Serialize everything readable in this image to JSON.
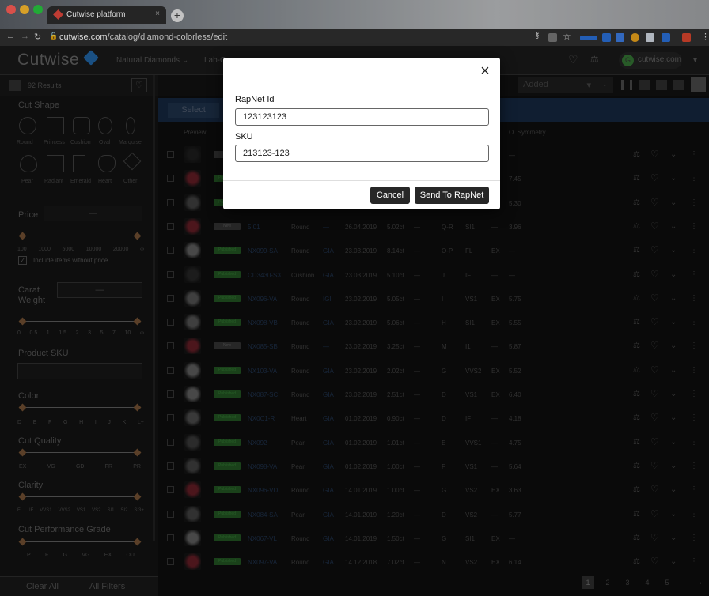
{
  "browser": {
    "tab_title": "Cutwise platform",
    "close_tab": "×",
    "new_tab": "+",
    "url_host": "cutwise.com",
    "url_path": "/catalog/diamond-colorless/edit"
  },
  "header": {
    "logo": "Cutwise",
    "nav": [
      {
        "label": "Natural Diamonds"
      },
      {
        "label": "Lab-G"
      }
    ],
    "user": "cutwise.com",
    "user_initial": "G"
  },
  "sidebar": {
    "results": "92 Results",
    "cut_shape": "Cut Shape",
    "shapes_row1": [
      "Round",
      "Princess",
      "Cushion",
      "Oval",
      "Marquise"
    ],
    "shapes_row2": [
      "Pear",
      "Radiant",
      "Emerald",
      "Heart",
      "Other"
    ],
    "price": "Price",
    "price_dash": "—",
    "price_ticks": [
      "100",
      "1000",
      "5000",
      "10000",
      "20000",
      "∞"
    ],
    "include_without_price": "Include items without price",
    "carat_weight": "Carat Weight",
    "carat_ticks": [
      "0",
      "0.5",
      "1",
      "1.5",
      "2",
      "3",
      "5",
      "7",
      "10",
      "∞"
    ],
    "product_sku": "Product SKU",
    "color": "Color",
    "color_ticks": [
      "D",
      "E",
      "F",
      "G",
      "H",
      "I",
      "J",
      "K",
      "L+"
    ],
    "cut_quality": "Cut Quality",
    "cut_quality_ticks": [
      "EX",
      "VG",
      "GD",
      "FR",
      "PR"
    ],
    "clarity": "Clarity",
    "clarity_ticks": [
      "FL",
      "IF",
      "VVS1",
      "VVS2",
      "VS1",
      "VS2",
      "SI1",
      "SI2",
      "SI3+"
    ],
    "cut_performance": "Cut Performance Grade",
    "cut_performance_ticks": [
      "P",
      "F",
      "G",
      "VG",
      "EX",
      "OU"
    ],
    "clear_all": "Clear All",
    "all_filters": "All Filters"
  },
  "toolbar": {
    "sort_label": "Added",
    "select_button": "Select"
  },
  "table": {
    "preview_header": "Preview",
    "symmetry_header": "O. Symmetry",
    "rows": [
      {
        "status": "New",
        "sku": "",
        "shape": "",
        "lab": "",
        "date": "",
        "carat": "",
        "cut": "",
        "color": "",
        "clarity": "",
        "sym": "",
        "score": "—",
        "thumb": "#1a1a1a"
      },
      {
        "status": "Published",
        "sku": "",
        "shape": "",
        "lab": "",
        "date": "",
        "carat": "",
        "cut": "",
        "color": "",
        "clarity": "",
        "sym": "",
        "score": "7.45",
        "thumb": "#5a1a22"
      },
      {
        "status": "Published",
        "sku": "",
        "shape": "",
        "lab": "",
        "date": "",
        "carat": "",
        "cut": "",
        "color": "",
        "clarity": "",
        "sym": "",
        "score": "5.30",
        "thumb": "#3a3a3a"
      },
      {
        "status": "New",
        "sku": "5.01",
        "shape": "Round",
        "lab": "—",
        "date": "26.04.2019",
        "carat": "5.02ct",
        "cut": "—",
        "color": "Q-R",
        "clarity": "SI1",
        "sym": "—",
        "score": "3.96",
        "thumb": "#5a1a22"
      },
      {
        "status": "Published",
        "sku": "NX099-SA",
        "shape": "Round",
        "lab": "GIA",
        "date": "23.03.2019",
        "carat": "8.14ct",
        "cut": "—",
        "color": "O-P",
        "clarity": "FL",
        "sym": "EX",
        "score": "—",
        "thumb": "#555555"
      },
      {
        "status": "Published",
        "sku": "CD3430-S3",
        "shape": "Cushion",
        "lab": "GIA",
        "date": "23.03.2019",
        "carat": "5.10ct",
        "cut": "—",
        "color": "J",
        "clarity": "IF",
        "sym": "—",
        "score": "—",
        "thumb": "#222222"
      },
      {
        "status": "Published",
        "sku": "NX096-VA",
        "shape": "Round",
        "lab": "IGI",
        "date": "23.02.2019",
        "carat": "5.05ct",
        "cut": "—",
        "color": "I",
        "clarity": "VS1",
        "sym": "EX",
        "score": "5.75",
        "thumb": "#4a4a4a"
      },
      {
        "status": "Published",
        "sku": "NX098-VB",
        "shape": "Round",
        "lab": "GIA",
        "date": "23.02.2019",
        "carat": "5.06ct",
        "cut": "—",
        "color": "H",
        "clarity": "SI1",
        "sym": "EX",
        "score": "5.55",
        "thumb": "#4a4a4a"
      },
      {
        "status": "New",
        "sku": "NX085-SB",
        "shape": "Round",
        "lab": "—",
        "date": "23.02.2019",
        "carat": "3.25ct",
        "cut": "—",
        "color": "M",
        "clarity": "I1",
        "sym": "—",
        "score": "5.87",
        "thumb": "#5a1a22"
      },
      {
        "status": "Published",
        "sku": "NX103-VA",
        "shape": "Round",
        "lab": "GIA",
        "date": "23.02.2019",
        "carat": "2.02ct",
        "cut": "—",
        "color": "G",
        "clarity": "VVS2",
        "sym": "EX",
        "score": "5.52",
        "thumb": "#555555"
      },
      {
        "status": "Published",
        "sku": "NX087-SC",
        "shape": "Round",
        "lab": "GIA",
        "date": "23.02.2019",
        "carat": "2.51ct",
        "cut": "—",
        "color": "D",
        "clarity": "VS1",
        "sym": "EX",
        "score": "6.40",
        "thumb": "#555555"
      },
      {
        "status": "Published",
        "sku": "NX0C1-R",
        "shape": "Heart",
        "lab": "GIA",
        "date": "01.02.2019",
        "carat": "0.90ct",
        "cut": "—",
        "color": "D",
        "clarity": "IF",
        "sym": "—",
        "score": "4.18",
        "thumb": "#444444"
      },
      {
        "status": "Published",
        "sku": "NX092",
        "shape": "Pear",
        "lab": "GIA",
        "date": "01.02.2019",
        "carat": "1.01ct",
        "cut": "—",
        "color": "E",
        "clarity": "VVS1",
        "sym": "—",
        "score": "4.75",
        "thumb": "#333333"
      },
      {
        "status": "Published",
        "sku": "NX098-VA",
        "shape": "Pear",
        "lab": "GIA",
        "date": "01.02.2019",
        "carat": "1.00ct",
        "cut": "—",
        "color": "F",
        "clarity": "VS1",
        "sym": "—",
        "score": "5.64",
        "thumb": "#3a3a3a"
      },
      {
        "status": "Published",
        "sku": "NX096-VD",
        "shape": "Round",
        "lab": "GIA",
        "date": "14.01.2019",
        "carat": "1.00ct",
        "cut": "—",
        "color": "G",
        "clarity": "VS2",
        "sym": "EX",
        "score": "3.63",
        "thumb": "#5a1a22"
      },
      {
        "status": "Published",
        "sku": "NX084-SA",
        "shape": "Pear",
        "lab": "GIA",
        "date": "14.01.2019",
        "carat": "1.20ct",
        "cut": "—",
        "color": "D",
        "clarity": "VS2",
        "sym": "—",
        "score": "5.77",
        "thumb": "#3a3a3a"
      },
      {
        "status": "Published",
        "sku": "NX067-VL",
        "shape": "Round",
        "lab": "GIA",
        "date": "14.01.2019",
        "carat": "1.50ct",
        "cut": "—",
        "color": "G",
        "clarity": "SI1",
        "sym": "EX",
        "score": "—",
        "thumb": "#555555"
      },
      {
        "status": "Published",
        "sku": "NX097-VA",
        "shape": "Round",
        "lab": "GIA",
        "date": "14.12.2018",
        "carat": "7.02ct",
        "cut": "—",
        "color": "N",
        "clarity": "VS2",
        "sym": "EX",
        "score": "6.14",
        "thumb": "#5a1a22"
      }
    ]
  },
  "pagination": {
    "pages": [
      "1",
      "2",
      "3",
      "4",
      "5"
    ],
    "next": "›",
    "active": "1"
  },
  "modal": {
    "close": "×",
    "rapnet_label": "RapNet Id",
    "rapnet_value": "123123123",
    "sku_label": "SKU",
    "sku_value": "213123-123",
    "cancel": "Cancel",
    "send": "Send To RapNet"
  }
}
